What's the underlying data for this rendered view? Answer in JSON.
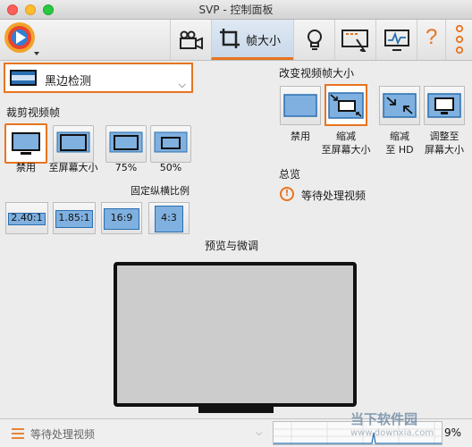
{
  "window": {
    "title": "SVP - 控制面板"
  },
  "toolbar": {
    "active_tab_label": "帧大小",
    "help_glyph": "?",
    "icons": [
      "svp-logo-icon",
      "video-camera-icon",
      "crop-icon",
      "lightbulb-icon",
      "screen-pointer-icon",
      "monitor-graph-icon",
      "help-icon",
      "more-icon"
    ]
  },
  "preset": {
    "label": "黑边检测"
  },
  "crop": {
    "title": "裁剪视频帧",
    "options": [
      {
        "caption": "禁用",
        "selected": true
      },
      {
        "caption": "至屏幕大小",
        "selected": false
      },
      {
        "caption": "75%",
        "selected": false
      },
      {
        "caption": "50%",
        "selected": false
      }
    ],
    "fixed_ratio_title": "固定纵横比例",
    "ratios": [
      "2.40:1",
      "1.85:1",
      "16:9",
      "4:3"
    ]
  },
  "resize": {
    "title": "改变视频帧大小",
    "options": [
      {
        "caption_line1": "禁用",
        "caption_line2": "",
        "selected": false
      },
      {
        "caption_line1": "缩减",
        "caption_line2": "至屏幕大小",
        "selected": true
      },
      {
        "caption_line1": "缩减",
        "caption_line2": "至 HD",
        "selected": false
      },
      {
        "caption_line1": "调整至",
        "caption_line2": "屏幕大小",
        "selected": false
      }
    ]
  },
  "summary": {
    "title": "总览",
    "status": "等待处理视频"
  },
  "preview": {
    "title": "预览与微调"
  },
  "bottom": {
    "status": "等待处理视频",
    "cpu_percent": "9%"
  },
  "watermark": {
    "line1": "当下软件园",
    "line2": "www.downxia.com"
  },
  "colors": {
    "accent": "#e8741f",
    "blue": "#2a6fb0",
    "light_blue": "#7fb0df"
  }
}
